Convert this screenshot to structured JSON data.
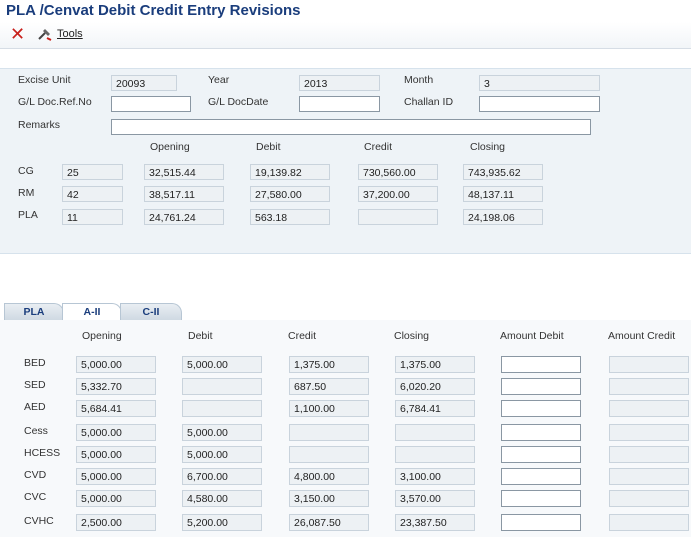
{
  "window": {
    "title": "PLA /Cenvat Debit Credit Entry Revisions"
  },
  "toolbar": {
    "tools_label": "Tools"
  },
  "header": {
    "excise_unit_label": "Excise Unit",
    "excise_unit_value": "20093",
    "year_label": "Year",
    "year_value": "2013",
    "month_label": "Month",
    "month_value": "3",
    "gl_ref_label": "G/L Doc.Ref.No",
    "gl_ref_value": "",
    "gl_date_label": "G/L DocDate",
    "gl_date_value": "",
    "challan_label": "Challan ID",
    "challan_value": "",
    "remarks_label": "Remarks",
    "remarks_value": ""
  },
  "summary": {
    "columns": [
      "Opening",
      "Debit",
      "Credit",
      "Closing"
    ],
    "rows": [
      {
        "label": "CG",
        "code": "25",
        "opening": "32,515.44",
        "debit": "19,139.82",
        "credit": "730,560.00",
        "closing": "743,935.62"
      },
      {
        "label": "RM",
        "code": "42",
        "opening": "38,517.11",
        "debit": "27,580.00",
        "credit": "37,200.00",
        "closing": "48,137.11"
      },
      {
        "label": "PLA",
        "code": "11",
        "opening": "24,761.24",
        "debit": "563.18",
        "credit": "",
        "closing": "24,198.06"
      }
    ]
  },
  "tabs": [
    {
      "label": "PLA",
      "active": false
    },
    {
      "label": "A-II",
      "active": true
    },
    {
      "label": "C-II",
      "active": false
    }
  ],
  "detail": {
    "columns": [
      "Opening",
      "Debit",
      "Credit",
      "Closing",
      "Amount Debit",
      "Amount Credit"
    ],
    "rows": [
      {
        "label": "BED",
        "opening": "5,000.00",
        "debit": "5,000.00",
        "credit": "1,375.00",
        "closing": "1,375.00",
        "amount_debit": "",
        "amount_credit": ""
      },
      {
        "label": "SED",
        "opening": "5,332.70",
        "debit": "",
        "credit": "687.50",
        "closing": "6,020.20",
        "amount_debit": "",
        "amount_credit": ""
      },
      {
        "label": "AED",
        "opening": "5,684.41",
        "debit": "",
        "credit": "1,100.00",
        "closing": "6,784.41",
        "amount_debit": "",
        "amount_credit": ""
      },
      {
        "label": "Cess",
        "opening": "5,000.00",
        "debit": "5,000.00",
        "credit": "",
        "closing": "",
        "amount_debit": "",
        "amount_credit": ""
      },
      {
        "label": "HCESS",
        "opening": "5,000.00",
        "debit": "5,000.00",
        "credit": "",
        "closing": "",
        "amount_debit": "",
        "amount_credit": ""
      },
      {
        "label": "CVD",
        "opening": "5,000.00",
        "debit": "6,700.00",
        "credit": "4,800.00",
        "closing": "3,100.00",
        "amount_debit": "",
        "amount_credit": ""
      },
      {
        "label": "CVC",
        "opening": "5,000.00",
        "debit": "4,580.00",
        "credit": "3,150.00",
        "closing": "3,570.00",
        "amount_debit": "",
        "amount_credit": ""
      },
      {
        "label": "CVHC",
        "opening": "2,500.00",
        "debit": "5,200.00",
        "credit": "26,087.50",
        "closing": "23,387.50",
        "amount_debit": "",
        "amount_credit": ""
      }
    ]
  }
}
